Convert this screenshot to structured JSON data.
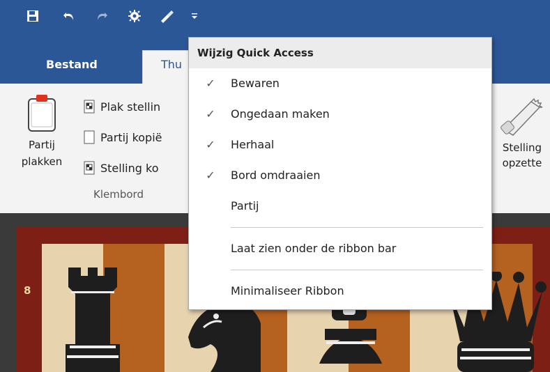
{
  "tabs": {
    "file": "Bestand",
    "home": "Thu"
  },
  "ribbon": {
    "paste_game": [
      "Partij",
      "plakken"
    ],
    "small_items": [
      "Plak stellin",
      "Partij kopië",
      "Stelling ko"
    ],
    "group_label": "Klembord",
    "setup_position": [
      "Stelling",
      "opzette"
    ]
  },
  "board": {
    "rank_label": "8"
  },
  "menu": {
    "header": "Wijzig Quick Access",
    "items": [
      {
        "label": "Bewaren",
        "checked": true
      },
      {
        "label": "Ongedaan maken",
        "checked": true
      },
      {
        "label": "Herhaal",
        "checked": true
      },
      {
        "label": "Bord omdraaien",
        "checked": true
      },
      {
        "label": "Partij",
        "checked": false
      }
    ],
    "check_glyph": "✓",
    "show_below": "Laat zien onder de ribbon bar",
    "minimize": "Minimaliseer Ribbon"
  },
  "colors": {
    "title_blue": "#2b5797",
    "ribbon_bg": "#f3f3f3",
    "menu_header_bg": "#ececec"
  },
  "icons": [
    "save-icon",
    "undo-icon",
    "redo-icon",
    "engine-icon",
    "flashlight-icon",
    "customize-dropdown-icon"
  ]
}
